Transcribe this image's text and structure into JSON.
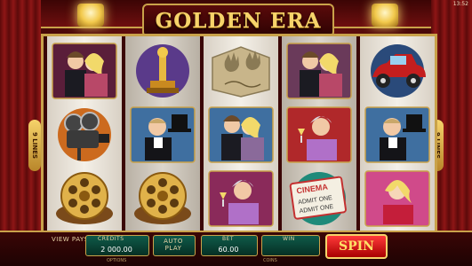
{
  "game": {
    "title": "GOLDEN ERA",
    "clock": "13:52"
  },
  "reels": [
    [
      "couple-icon",
      "film-camera-icon",
      "film-reel-icon"
    ],
    [
      "award-trophy-icon",
      "gentleman-tophat-icon",
      "film-reel-icon"
    ],
    [
      "handprint-plaque-icon",
      "couple-icon",
      "lady-glass-icon"
    ],
    [
      "couple-icon",
      "lady-glass-icon",
      "admit-one-ticket-icon"
    ],
    [
      "vintage-car-icon",
      "gentleman-tophat-icon",
      "blonde-lady-icon"
    ]
  ],
  "ticket": {
    "brand": "CINEMA",
    "line1": "ADMIT ONE",
    "line2": "ADMIT ONE"
  },
  "paylines": {
    "left": "9 LINES",
    "right": "9 LINES"
  },
  "controls": {
    "view_pays": "VIEW PAYS",
    "credits_label": "CREDITS",
    "credits_value": "2 000.00",
    "autoplay_label": "AUTO PLAY",
    "bet_label": "BET",
    "bet_value": "60.00",
    "win_label": "WIN",
    "win_value": "",
    "spin_label": "SPIN"
  },
  "footer": {
    "options": "OPTIONS",
    "coins": "COINS"
  },
  "colors": {
    "gold": "#c9a24a",
    "spin_red": "#d00000",
    "panel_teal": "#0f5a4a"
  }
}
